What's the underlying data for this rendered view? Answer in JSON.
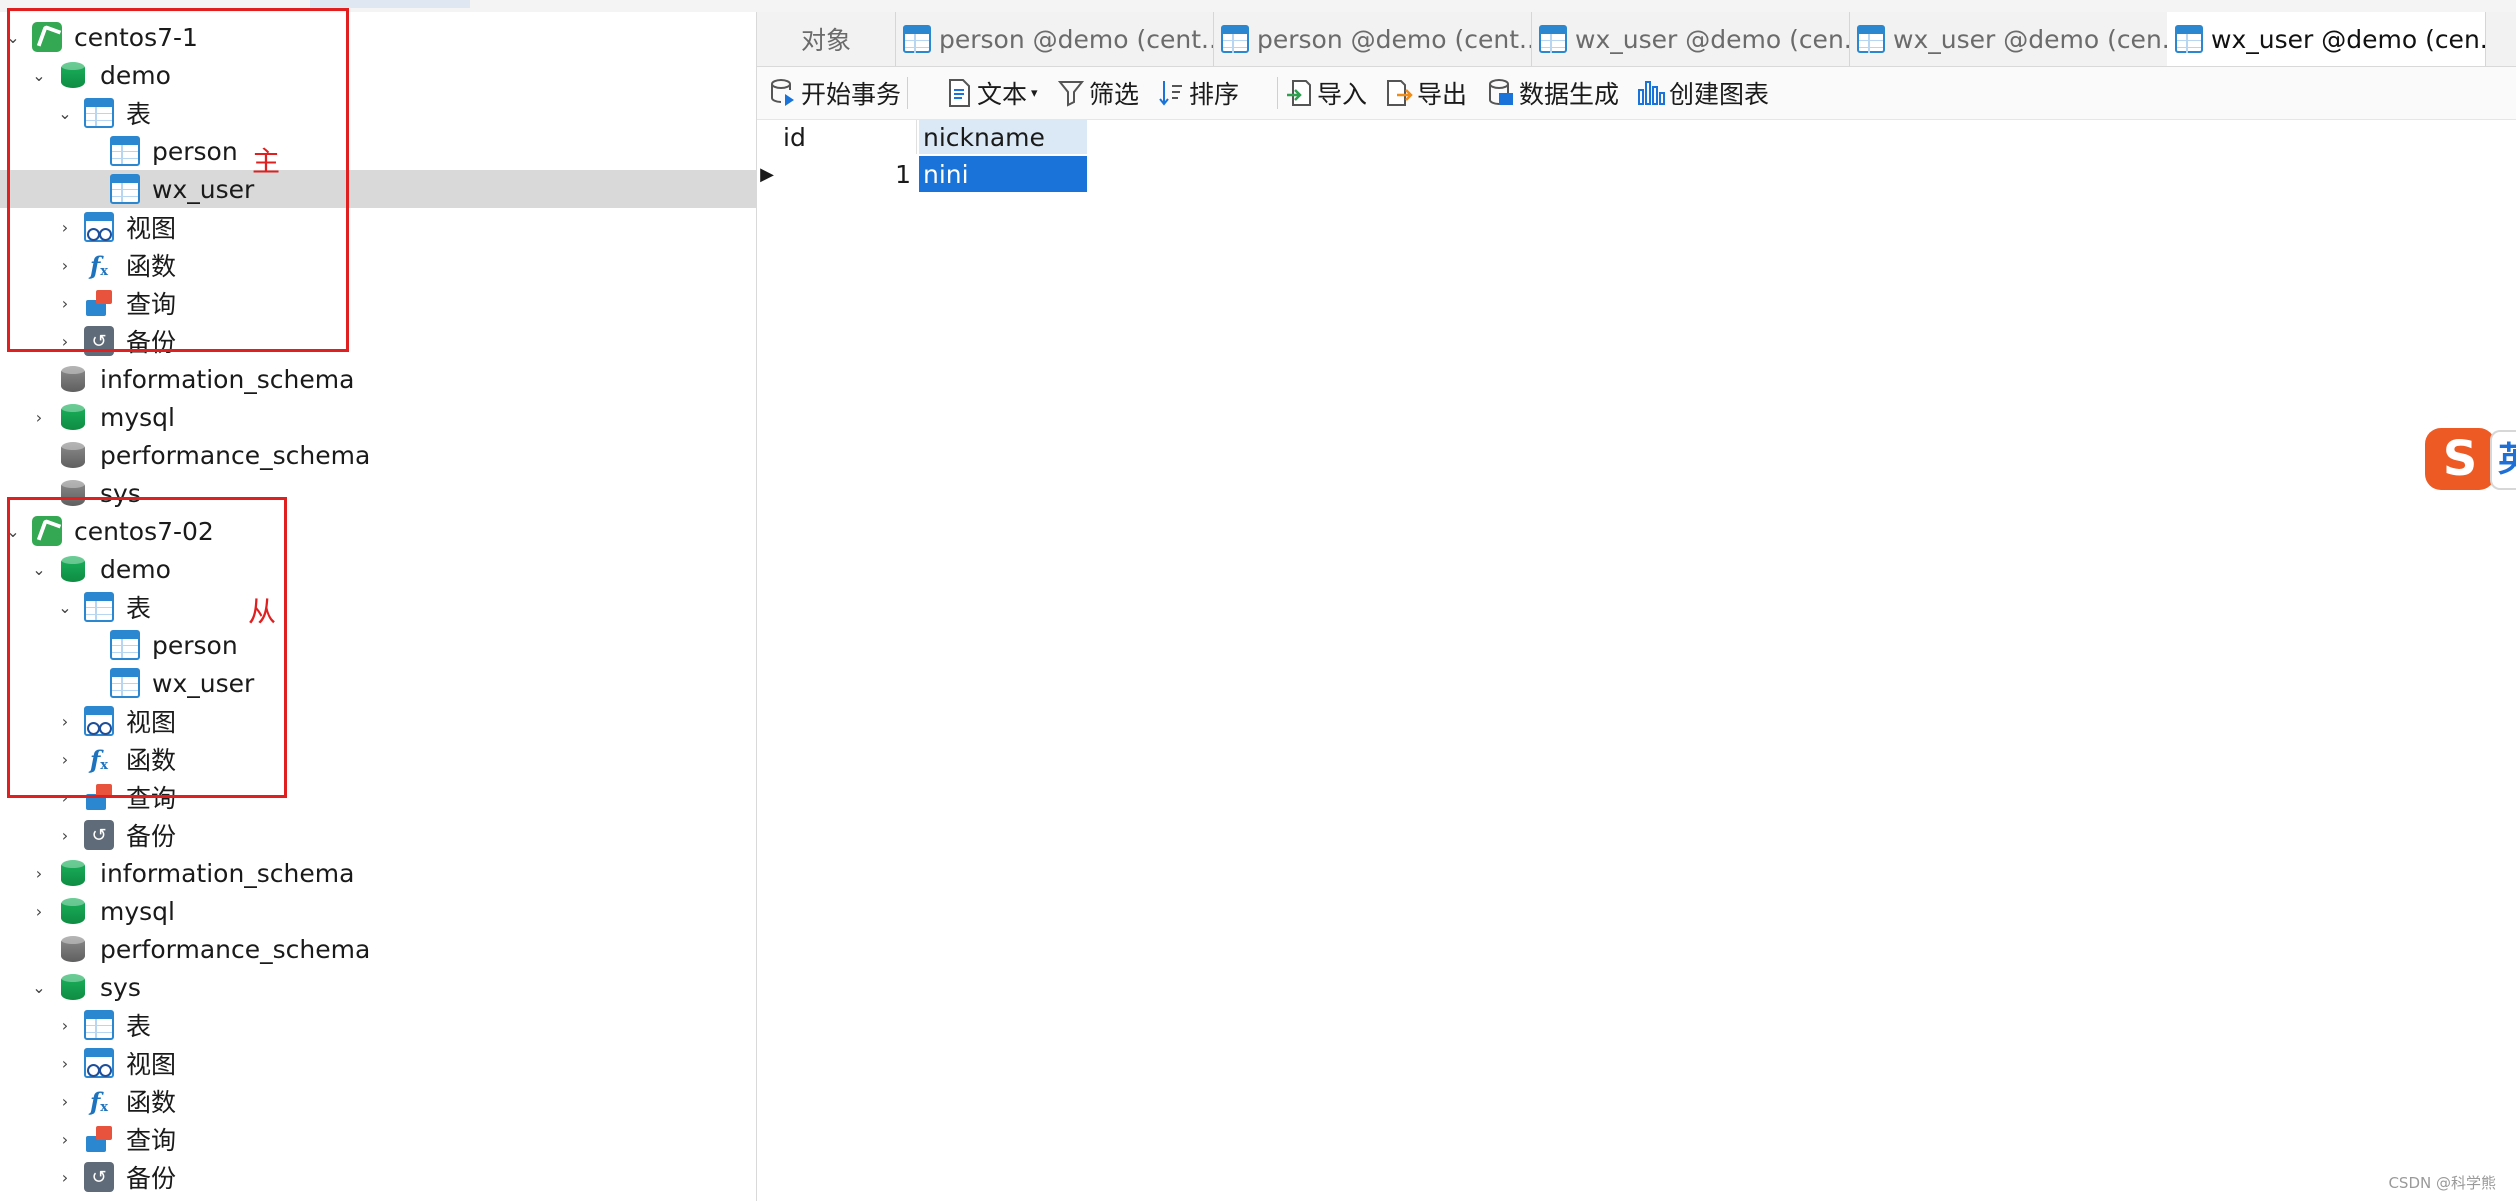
{
  "tree": {
    "conn1": {
      "name": "centos7-1",
      "db": "demo",
      "tables_folder": "表",
      "tables": [
        "person",
        "wx_user"
      ],
      "views": "视图",
      "functions": "函数",
      "queries": "查询",
      "backups": "备份"
    },
    "conn1_other_dbs": [
      "information_schema",
      "mysql",
      "performance_schema",
      "sys"
    ],
    "conn2": {
      "name": "centos7-02",
      "db": "demo",
      "tables_folder": "表",
      "tables": [
        "person",
        "wx_user"
      ],
      "views": "视图",
      "functions": "函数",
      "queries": "查询",
      "backups": "备份"
    },
    "conn2_other_dbs": [
      "information_schema",
      "mysql",
      "performance_schema",
      "sys"
    ],
    "sys_children": [
      "表",
      "视图",
      "函数",
      "查询",
      "备份"
    ]
  },
  "annotations": {
    "master": "主",
    "slave": "从"
  },
  "tabs": [
    "对象",
    "person @demo (cent...",
    "person @demo (cent...",
    "wx_user @demo (cen...",
    "wx_user @demo (cen...",
    "wx_user @demo (cen..."
  ],
  "toolbar": {
    "begin_transaction": "开始事务",
    "text": "文本",
    "filter": "筛选",
    "sort": "排序",
    "import": "导入",
    "export": "导出",
    "data_generation": "数据生成",
    "create_chart": "创建图表"
  },
  "grid": {
    "columns": [
      "id",
      "nickname"
    ],
    "rows": [
      {
        "id": "1",
        "nickname": "nini"
      }
    ]
  },
  "ime_glyph": "S",
  "ime_edge_glyph": "英",
  "watermark": "CSDN @科学熊",
  "colors": {
    "accent": "#1a73d8",
    "annotation_red": "#e02020",
    "selected_row": "#d9d9d9"
  }
}
